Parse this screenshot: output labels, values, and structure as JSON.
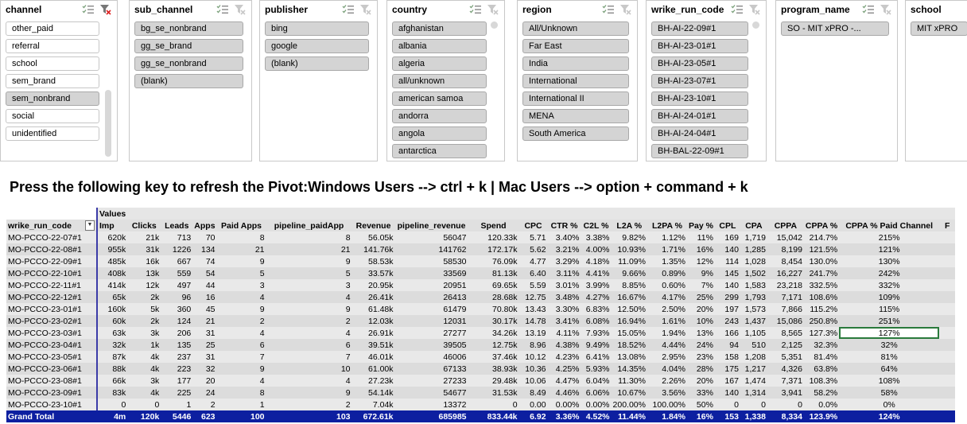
{
  "slicers": [
    {
      "title": "channel",
      "items": [
        {
          "label": "other_paid",
          "selected": false
        },
        {
          "label": "referral",
          "selected": false
        },
        {
          "label": "school",
          "selected": false
        },
        {
          "label": "sem_brand",
          "selected": false
        },
        {
          "label": "sem_nonbrand",
          "selected": true
        },
        {
          "label": "social",
          "selected": false
        },
        {
          "label": "unidentified",
          "selected": false
        }
      ]
    },
    {
      "title": "sub_channel",
      "items": [
        {
          "label": "bg_se_nonbrand",
          "selected": true
        },
        {
          "label": "gg_se_brand",
          "selected": true
        },
        {
          "label": "gg_se_nonbrand",
          "selected": true
        },
        {
          "label": "(blank)",
          "selected": true
        }
      ]
    },
    {
      "title": "publisher",
      "items": [
        {
          "label": "bing",
          "selected": true
        },
        {
          "label": "google",
          "selected": true
        },
        {
          "label": "(blank)",
          "selected": true
        }
      ]
    },
    {
      "title": "country",
      "items": [
        {
          "label": "afghanistan",
          "selected": true
        },
        {
          "label": "albania",
          "selected": true
        },
        {
          "label": "algeria",
          "selected": true
        },
        {
          "label": "all/unknown",
          "selected": true
        },
        {
          "label": "american samoa",
          "selected": true
        },
        {
          "label": "andorra",
          "selected": true
        },
        {
          "label": "angola",
          "selected": true
        },
        {
          "label": "antarctica",
          "selected": true
        }
      ]
    },
    {
      "title": "region",
      "items": [
        {
          "label": "All/Unknown",
          "selected": true
        },
        {
          "label": "Far East",
          "selected": true
        },
        {
          "label": "India",
          "selected": true
        },
        {
          "label": "International",
          "selected": true
        },
        {
          "label": "International  II",
          "selected": true
        },
        {
          "label": "MENA",
          "selected": true
        },
        {
          "label": "South America",
          "selected": true
        }
      ]
    },
    {
      "title": "wrike_run_code",
      "items": [
        {
          "label": "BH-AI-22-09#1",
          "selected": true
        },
        {
          "label": "BH-AI-23-01#1",
          "selected": true
        },
        {
          "label": "BH-AI-23-05#1",
          "selected": true
        },
        {
          "label": "BH-AI-23-07#1",
          "selected": true
        },
        {
          "label": "BH-AI-23-10#1",
          "selected": true
        },
        {
          "label": "BH-AI-24-01#1",
          "selected": true
        },
        {
          "label": "BH-AI-24-04#1",
          "selected": true
        },
        {
          "label": "BH-BAL-22-09#1",
          "selected": true
        }
      ]
    },
    {
      "title": "program_name",
      "items": [
        {
          "label": "SO - MIT xPRO -...",
          "selected": true
        }
      ]
    },
    {
      "title": "school",
      "items": [
        {
          "label": "MIT xPRO",
          "selected": true
        }
      ]
    }
  ],
  "instruction": "Press the following key to refresh the Pivot:Windows Users --> ctrl + k | Mac Users --> option + command + k",
  "pivot": {
    "values_label": "Values",
    "row_field": "wrike_run_code",
    "columns": [
      "Imp",
      "Clicks",
      "Leads",
      "Apps",
      "Paid Apps",
      "pipeline_paidApp",
      "Revenue",
      "pipeline_revenue",
      "Spend",
      "CPC",
      "CTR %",
      "C2L %",
      "L2A %",
      "L2PA %",
      "Pay %",
      "CPL",
      "CPA",
      "CPPA",
      "CPPA %",
      "CPPA % Paid Channel",
      "F"
    ],
    "rows": [
      [
        "MO-PCCO-22-07#1",
        "620k",
        "21k",
        "713",
        "70",
        "8",
        "8",
        "56.05k",
        "56047",
        "120.33k",
        "5.71",
        "3.40%",
        "3.38%",
        "9.82%",
        "1.12%",
        "11%",
        "169",
        "1,719",
        "15,042",
        "214.7%",
        "215%",
        ""
      ],
      [
        "MO-PCCO-22-08#1",
        "955k",
        "31k",
        "1226",
        "134",
        "21",
        "21",
        "141.76k",
        "141762",
        "172.17k",
        "5.62",
        "3.21%",
        "4.00%",
        "10.93%",
        "1.71%",
        "16%",
        "140",
        "1,285",
        "8,199",
        "121.5%",
        "121%",
        ""
      ],
      [
        "MO-PCCO-22-09#1",
        "485k",
        "16k",
        "667",
        "74",
        "9",
        "9",
        "58.53k",
        "58530",
        "76.09k",
        "4.77",
        "3.29%",
        "4.18%",
        "11.09%",
        "1.35%",
        "12%",
        "114",
        "1,028",
        "8,454",
        "130.0%",
        "130%",
        ""
      ],
      [
        "MO-PCCO-22-10#1",
        "408k",
        "13k",
        "559",
        "54",
        "5",
        "5",
        "33.57k",
        "33569",
        "81.13k",
        "6.40",
        "3.11%",
        "4.41%",
        "9.66%",
        "0.89%",
        "9%",
        "145",
        "1,502",
        "16,227",
        "241.7%",
        "242%",
        ""
      ],
      [
        "MO-PCCO-22-11#1",
        "414k",
        "12k",
        "497",
        "44",
        "3",
        "3",
        "20.95k",
        "20951",
        "69.65k",
        "5.59",
        "3.01%",
        "3.99%",
        "8.85%",
        "0.60%",
        "7%",
        "140",
        "1,583",
        "23,218",
        "332.5%",
        "332%",
        ""
      ],
      [
        "MO-PCCO-22-12#1",
        "65k",
        "2k",
        "96",
        "16",
        "4",
        "4",
        "26.41k",
        "26413",
        "28.68k",
        "12.75",
        "3.48%",
        "4.27%",
        "16.67%",
        "4.17%",
        "25%",
        "299",
        "1,793",
        "7,171",
        "108.6%",
        "109%",
        ""
      ],
      [
        "MO-PCCO-23-01#1",
        "160k",
        "5k",
        "360",
        "45",
        "9",
        "9",
        "61.48k",
        "61479",
        "70.80k",
        "13.43",
        "3.30%",
        "6.83%",
        "12.50%",
        "2.50%",
        "20%",
        "197",
        "1,573",
        "7,866",
        "115.2%",
        "115%",
        ""
      ],
      [
        "MO-PCCO-23-02#1",
        "60k",
        "2k",
        "124",
        "21",
        "2",
        "2",
        "12.03k",
        "12031",
        "30.17k",
        "14.78",
        "3.41%",
        "6.08%",
        "16.94%",
        "1.61%",
        "10%",
        "243",
        "1,437",
        "15,086",
        "250.8%",
        "251%",
        ""
      ],
      [
        "MO-PCCO-23-03#1",
        "63k",
        "3k",
        "206",
        "31",
        "4",
        "4",
        "26.91k",
        "27277",
        "34.26k",
        "13.19",
        "4.11%",
        "7.93%",
        "15.05%",
        "1.94%",
        "13%",
        "166",
        "1,105",
        "8,565",
        "127.3%",
        "127%",
        ""
      ],
      [
        "MO-PCCO-23-04#1",
        "32k",
        "1k",
        "135",
        "25",
        "6",
        "6",
        "39.51k",
        "39505",
        "12.75k",
        "8.96",
        "4.38%",
        "9.49%",
        "18.52%",
        "4.44%",
        "24%",
        "94",
        "510",
        "2,125",
        "32.3%",
        "32%",
        ""
      ],
      [
        "MO-PCCO-23-05#1",
        "87k",
        "4k",
        "237",
        "31",
        "7",
        "7",
        "46.01k",
        "46006",
        "37.46k",
        "10.12",
        "4.23%",
        "6.41%",
        "13.08%",
        "2.95%",
        "23%",
        "158",
        "1,208",
        "5,351",
        "81.4%",
        "81%",
        ""
      ],
      [
        "MO-PCCO-23-06#1",
        "88k",
        "4k",
        "223",
        "32",
        "9",
        "10",
        "61.00k",
        "67133",
        "38.93k",
        "10.36",
        "4.25%",
        "5.93%",
        "14.35%",
        "4.04%",
        "28%",
        "175",
        "1,217",
        "4,326",
        "63.8%",
        "64%",
        ""
      ],
      [
        "MO-PCCO-23-08#1",
        "66k",
        "3k",
        "177",
        "20",
        "4",
        "4",
        "27.23k",
        "27233",
        "29.48k",
        "10.06",
        "4.47%",
        "6.04%",
        "11.30%",
        "2.26%",
        "20%",
        "167",
        "1,474",
        "7,371",
        "108.3%",
        "108%",
        ""
      ],
      [
        "MO-PCCO-23-09#1",
        "83k",
        "4k",
        "225",
        "24",
        "8",
        "9",
        "54.14k",
        "54677",
        "31.53k",
        "8.49",
        "4.46%",
        "6.06%",
        "10.67%",
        "3.56%",
        "33%",
        "140",
        "1,314",
        "3,941",
        "58.2%",
        "58%",
        ""
      ],
      [
        "MO-PCCO-23-10#1",
        "0",
        "0",
        "1",
        "2",
        "1",
        "2",
        "7.04k",
        "13372",
        "0",
        "0.00",
        "0.00%",
        "0.00%",
        "200.00%",
        "100.00%",
        "50%",
        "0",
        "0",
        "0",
        "0.0%",
        "0%",
        ""
      ]
    ],
    "grand_total": [
      "Grand Total",
      "4m",
      "120k",
      "5446",
      "623",
      "100",
      "103",
      "672.61k",
      "685985",
      "833.44k",
      "6.92",
      "3.36%",
      "4.52%",
      "11.44%",
      "1.84%",
      "16%",
      "153",
      "1,338",
      "8,334",
      "123.9%",
      "124%",
      ""
    ]
  },
  "colors": {
    "grand_total_bg": "#0d1fa0",
    "border_accent": "#3b3ba8",
    "selected_cell": "#2a7a3c"
  },
  "icons": {
    "multi_select": "multi-select-icon",
    "clear_filter": "clear-filter-icon",
    "filter_dropdown": "filter-dropdown-icon"
  }
}
